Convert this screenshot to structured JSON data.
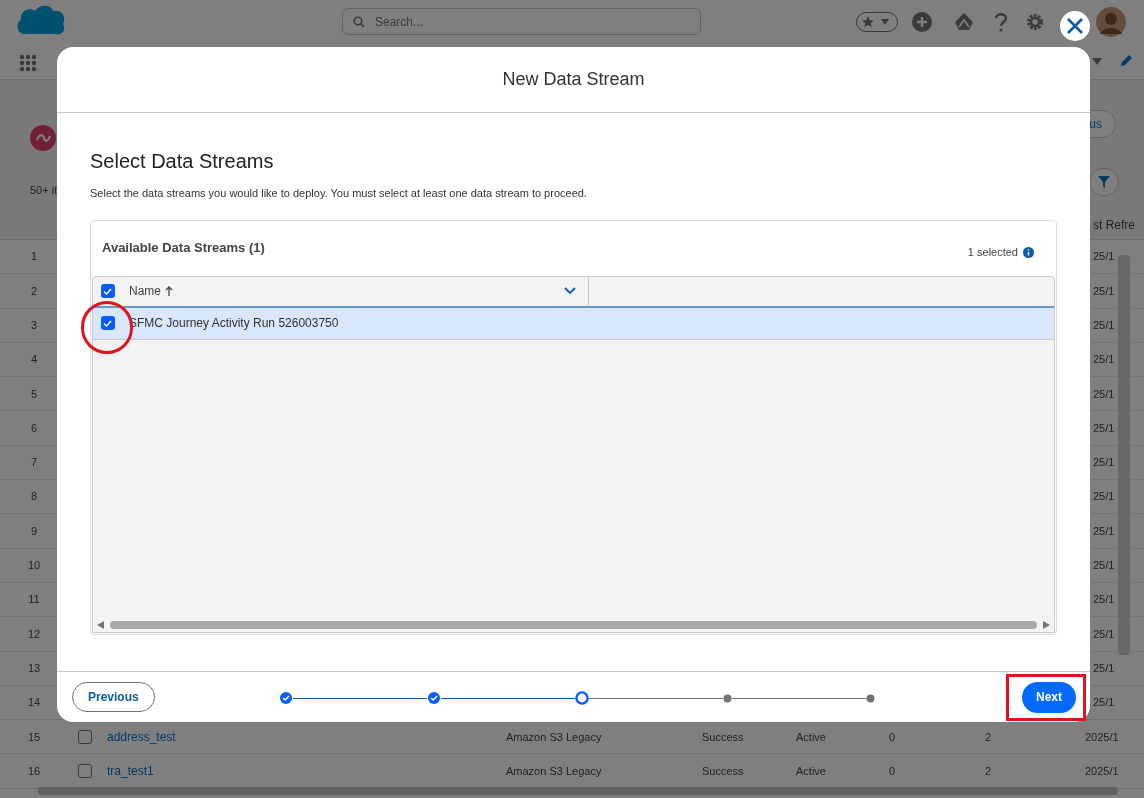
{
  "header": {
    "search_placeholder": "Search..."
  },
  "background": {
    "count": "50+ it",
    "button_label": "us",
    "last_refresh_header": "st Refre",
    "rows": [
      {
        "number": "1",
        "date": "25/1"
      },
      {
        "number": "2",
        "date": "25/1"
      },
      {
        "number": "3",
        "date": "25/1"
      },
      {
        "number": "4",
        "date": "25/1"
      },
      {
        "number": "5",
        "date": "25/1"
      },
      {
        "number": "6",
        "date": "25/1"
      },
      {
        "number": "7",
        "date": "25/1"
      },
      {
        "number": "8",
        "date": "25/1"
      },
      {
        "number": "9",
        "date": "25/1"
      },
      {
        "number": "10",
        "date": "25/1"
      },
      {
        "number": "11",
        "date": "25/1"
      },
      {
        "number": "12",
        "date": "25/1"
      },
      {
        "number": "13",
        "date": "25/1"
      },
      {
        "number": "14",
        "date": "25/1"
      },
      {
        "number": "15",
        "checked": false,
        "name": "address_test",
        "source": "Amazon S3 Legacy",
        "status": "Success",
        "state": "Active",
        "column_a": "0",
        "column_b": "2",
        "date": "2025/1"
      },
      {
        "number": "16",
        "checked": false,
        "name": "tra_test1",
        "source": "Amazon S3 Legacy",
        "status": "Success",
        "state": "Active",
        "column_a": "0",
        "column_b": "2",
        "date": "2025/1"
      }
    ]
  },
  "modal": {
    "title": "New Data Stream",
    "heading": "Select Data Streams",
    "description": "Select the data streams you would like to deploy. You must select at least one data stream to proceed.",
    "panel": {
      "title": "Available Data Streams (1)",
      "selected_count": "1 selected",
      "all_checked": true,
      "columns": [
        {
          "label": "Name"
        }
      ],
      "rows": [
        {
          "name": "SFMC Journey Activity Run 526003750",
          "checked": true,
          "selected": true
        }
      ]
    },
    "steps": [
      {
        "kind": "done"
      },
      {
        "kind": "done"
      },
      {
        "kind": "current"
      },
      {
        "kind": "pending"
      },
      {
        "kind": "pending"
      }
    ],
    "previous_button": "Previous",
    "next_button": "Next"
  },
  "annotations": [
    {
      "kind": "circle"
    },
    {
      "kind": "rectangle"
    }
  ]
}
